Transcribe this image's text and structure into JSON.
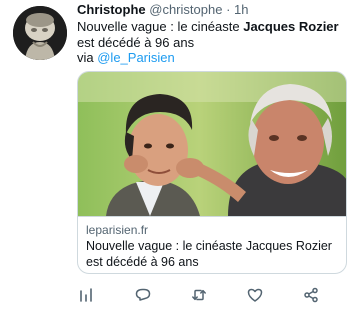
{
  "tweet": {
    "author_name": "Christophe",
    "author_handle": "@christophe",
    "separator": "·",
    "time": "1h",
    "text_before": "Nouvelle vague : le cinéaste ",
    "text_bold": "Jacques Rozier",
    "text_after": " est décédé à 96 ans",
    "via_label": "via ",
    "mention": "@le_Parisien"
  },
  "card": {
    "domain": "leparisien.fr",
    "title": "Nouvelle vague : le cinéaste Jacques Rozier est décédé à 96 ans"
  },
  "actions": {
    "icons": [
      "analytics-icon",
      "reply-icon",
      "retweet-icon",
      "like-icon",
      "share-icon"
    ]
  },
  "colors": {
    "accent": "#1d9bf0",
    "secondary_text": "#536471",
    "border": "#cfd9de"
  }
}
